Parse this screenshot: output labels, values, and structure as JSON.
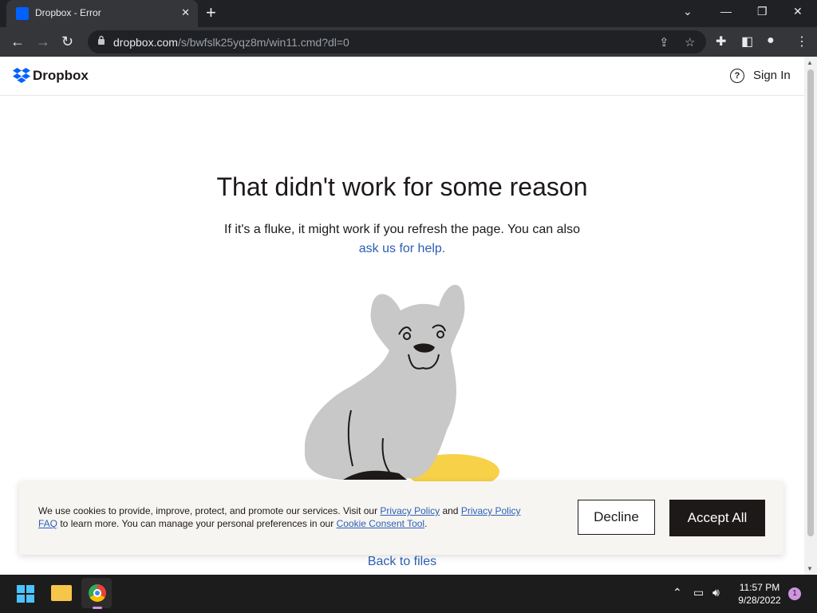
{
  "browser": {
    "tab_title": "Dropbox - Error",
    "url_host": "dropbox.com",
    "url_path": "/s/bwfslk25yqz8m/win11.cmd?dl=0"
  },
  "header": {
    "logo_text": "Dropbox",
    "signin_label": "Sign In"
  },
  "main": {
    "headline": "That didn't work for some reason",
    "subtext": "If it's a fluke, it might work if you refresh the page. You can also",
    "help_link": "ask us for help.",
    "back_link": "Back to files"
  },
  "cookie": {
    "text_1": "We use cookies to provide, improve, protect, and promote our services. Visit our ",
    "privacy_policy": "Privacy Policy",
    "text_2": " and ",
    "privacy_faq": "Privacy Policy FAQ",
    "text_3": " to learn more. You can manage your personal preferences in our ",
    "consent_tool": "Cookie Consent Tool",
    "text_4": ".",
    "decline_label": "Decline",
    "accept_label": "Accept All"
  },
  "taskbar": {
    "time": "11:57 PM",
    "date": "9/28/2022",
    "notification_count": "1"
  },
  "colors": {
    "link": "#2b5fb4",
    "brand": "#0061fe",
    "accept_bg": "#1e1919",
    "cookie_bg": "#f7f5f2"
  }
}
